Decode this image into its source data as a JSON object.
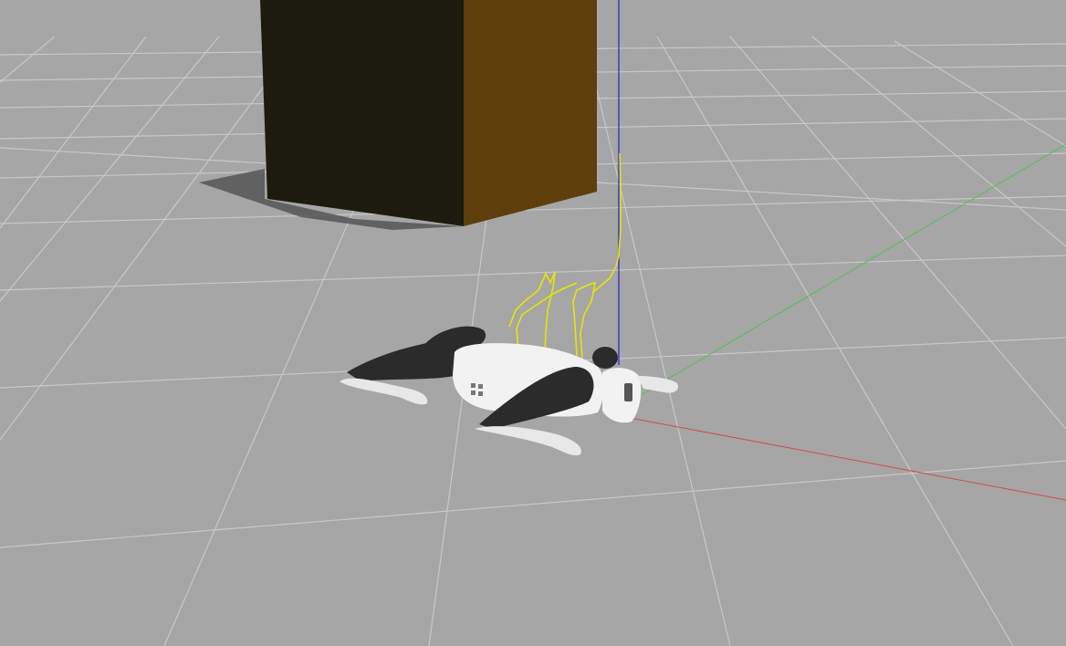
{
  "viewport": {
    "background_color": "#a6a6a6",
    "grid_line_color": "#c8c8c8"
  },
  "scene": {
    "axes": {
      "x_color": "#d24a4a",
      "y_color": "#4cc24c",
      "z_color": "#1f1fe0"
    },
    "box": {
      "front_color": "#1d1b10",
      "side_color": "#5e3e0a",
      "shadow_color": "#555555"
    },
    "robot": {
      "body_color": "#f2f2f2",
      "leg_color": "#2b2b2b",
      "foot_color": "#e8e8e8"
    },
    "trajectory": {
      "color": "#e6e600"
    }
  }
}
